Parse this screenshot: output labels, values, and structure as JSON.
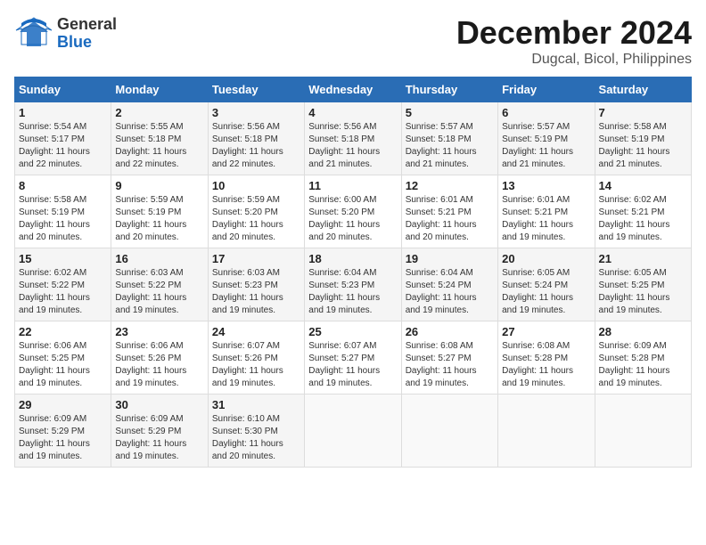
{
  "header": {
    "logo_general": "General",
    "logo_blue": "Blue",
    "month": "December 2024",
    "location": "Dugcal, Bicol, Philippines"
  },
  "days_of_week": [
    "Sunday",
    "Monday",
    "Tuesday",
    "Wednesday",
    "Thursday",
    "Friday",
    "Saturday"
  ],
  "weeks": [
    [
      {
        "day": "1",
        "info": "Sunrise: 5:54 AM\nSunset: 5:17 PM\nDaylight: 11 hours\nand 22 minutes."
      },
      {
        "day": "2",
        "info": "Sunrise: 5:55 AM\nSunset: 5:18 PM\nDaylight: 11 hours\nand 22 minutes."
      },
      {
        "day": "3",
        "info": "Sunrise: 5:56 AM\nSunset: 5:18 PM\nDaylight: 11 hours\nand 22 minutes."
      },
      {
        "day": "4",
        "info": "Sunrise: 5:56 AM\nSunset: 5:18 PM\nDaylight: 11 hours\nand 21 minutes."
      },
      {
        "day": "5",
        "info": "Sunrise: 5:57 AM\nSunset: 5:18 PM\nDaylight: 11 hours\nand 21 minutes."
      },
      {
        "day": "6",
        "info": "Sunrise: 5:57 AM\nSunset: 5:19 PM\nDaylight: 11 hours\nand 21 minutes."
      },
      {
        "day": "7",
        "info": "Sunrise: 5:58 AM\nSunset: 5:19 PM\nDaylight: 11 hours\nand 21 minutes."
      }
    ],
    [
      {
        "day": "8",
        "info": "Sunrise: 5:58 AM\nSunset: 5:19 PM\nDaylight: 11 hours\nand 20 minutes."
      },
      {
        "day": "9",
        "info": "Sunrise: 5:59 AM\nSunset: 5:19 PM\nDaylight: 11 hours\nand 20 minutes."
      },
      {
        "day": "10",
        "info": "Sunrise: 5:59 AM\nSunset: 5:20 PM\nDaylight: 11 hours\nand 20 minutes."
      },
      {
        "day": "11",
        "info": "Sunrise: 6:00 AM\nSunset: 5:20 PM\nDaylight: 11 hours\nand 20 minutes."
      },
      {
        "day": "12",
        "info": "Sunrise: 6:01 AM\nSunset: 5:21 PM\nDaylight: 11 hours\nand 20 minutes."
      },
      {
        "day": "13",
        "info": "Sunrise: 6:01 AM\nSunset: 5:21 PM\nDaylight: 11 hours\nand 19 minutes."
      },
      {
        "day": "14",
        "info": "Sunrise: 6:02 AM\nSunset: 5:21 PM\nDaylight: 11 hours\nand 19 minutes."
      }
    ],
    [
      {
        "day": "15",
        "info": "Sunrise: 6:02 AM\nSunset: 5:22 PM\nDaylight: 11 hours\nand 19 minutes."
      },
      {
        "day": "16",
        "info": "Sunrise: 6:03 AM\nSunset: 5:22 PM\nDaylight: 11 hours\nand 19 minutes."
      },
      {
        "day": "17",
        "info": "Sunrise: 6:03 AM\nSunset: 5:23 PM\nDaylight: 11 hours\nand 19 minutes."
      },
      {
        "day": "18",
        "info": "Sunrise: 6:04 AM\nSunset: 5:23 PM\nDaylight: 11 hours\nand 19 minutes."
      },
      {
        "day": "19",
        "info": "Sunrise: 6:04 AM\nSunset: 5:24 PM\nDaylight: 11 hours\nand 19 minutes."
      },
      {
        "day": "20",
        "info": "Sunrise: 6:05 AM\nSunset: 5:24 PM\nDaylight: 11 hours\nand 19 minutes."
      },
      {
        "day": "21",
        "info": "Sunrise: 6:05 AM\nSunset: 5:25 PM\nDaylight: 11 hours\nand 19 minutes."
      }
    ],
    [
      {
        "day": "22",
        "info": "Sunrise: 6:06 AM\nSunset: 5:25 PM\nDaylight: 11 hours\nand 19 minutes."
      },
      {
        "day": "23",
        "info": "Sunrise: 6:06 AM\nSunset: 5:26 PM\nDaylight: 11 hours\nand 19 minutes."
      },
      {
        "day": "24",
        "info": "Sunrise: 6:07 AM\nSunset: 5:26 PM\nDaylight: 11 hours\nand 19 minutes."
      },
      {
        "day": "25",
        "info": "Sunrise: 6:07 AM\nSunset: 5:27 PM\nDaylight: 11 hours\nand 19 minutes."
      },
      {
        "day": "26",
        "info": "Sunrise: 6:08 AM\nSunset: 5:27 PM\nDaylight: 11 hours\nand 19 minutes."
      },
      {
        "day": "27",
        "info": "Sunrise: 6:08 AM\nSunset: 5:28 PM\nDaylight: 11 hours\nand 19 minutes."
      },
      {
        "day": "28",
        "info": "Sunrise: 6:09 AM\nSunset: 5:28 PM\nDaylight: 11 hours\nand 19 minutes."
      }
    ],
    [
      {
        "day": "29",
        "info": "Sunrise: 6:09 AM\nSunset: 5:29 PM\nDaylight: 11 hours\nand 19 minutes."
      },
      {
        "day": "30",
        "info": "Sunrise: 6:09 AM\nSunset: 5:29 PM\nDaylight: 11 hours\nand 19 minutes."
      },
      {
        "day": "31",
        "info": "Sunrise: 6:10 AM\nSunset: 5:30 PM\nDaylight: 11 hours\nand 20 minutes."
      },
      {
        "day": "",
        "info": ""
      },
      {
        "day": "",
        "info": ""
      },
      {
        "day": "",
        "info": ""
      },
      {
        "day": "",
        "info": ""
      }
    ]
  ]
}
